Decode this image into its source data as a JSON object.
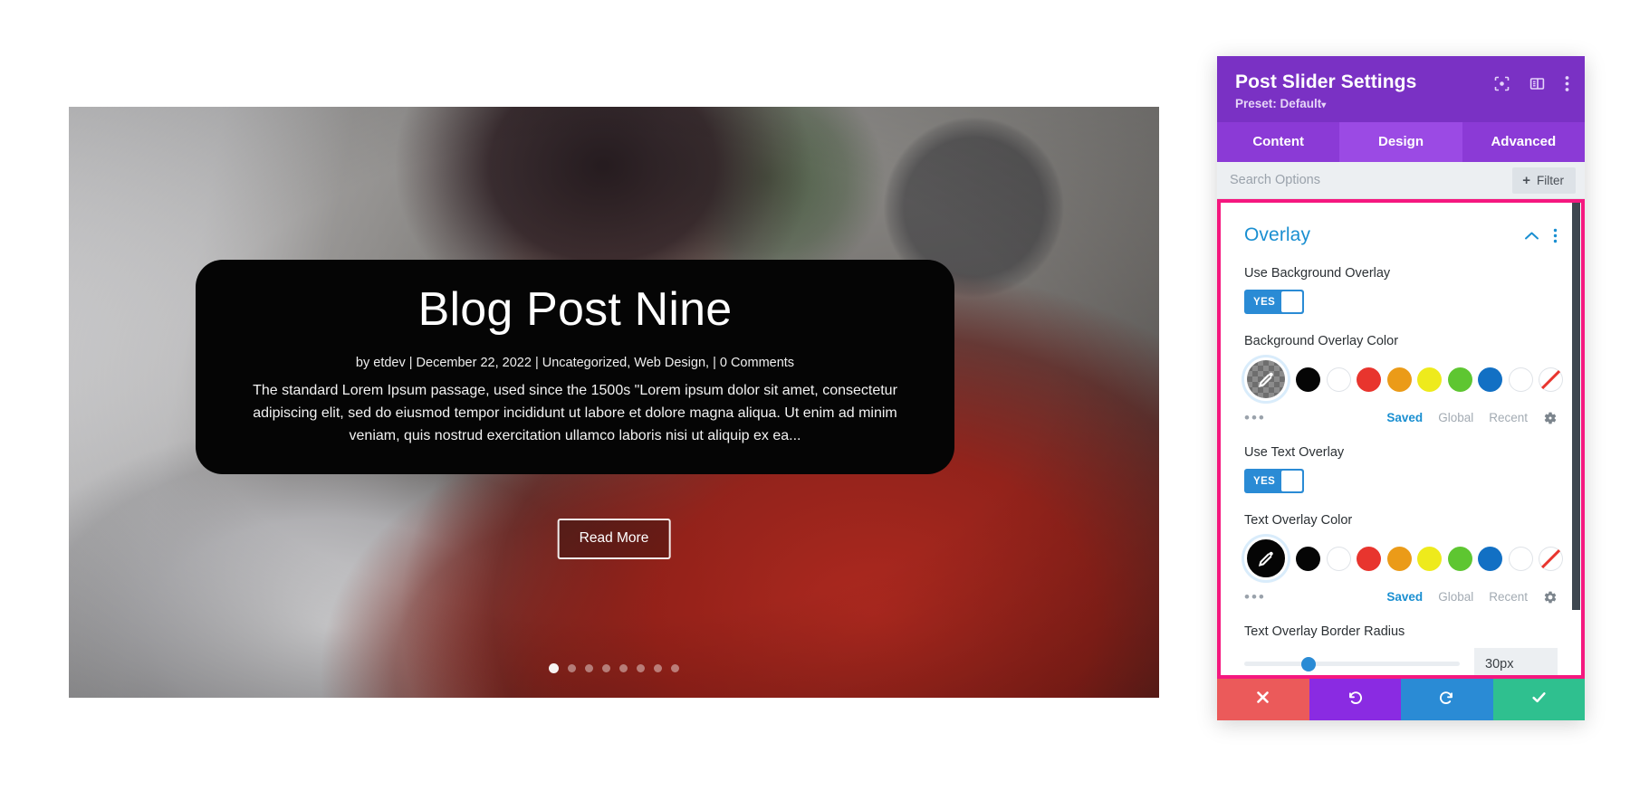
{
  "hero": {
    "post_title": "Blog Post Nine",
    "post_meta": "by etdev | December 22, 2022 | Uncategorized, Web Design, | 0 Comments",
    "post_excerpt": "The standard Lorem Ipsum passage, used since the 1500s \"Lorem ipsum dolor sit amet, consectetur adipiscing elit, sed do eiusmod tempor incididunt ut labore et dolore magna aliqua. Ut enim ad minim veniam, quis nostrud exercitation ullamco laboris nisi ut aliquip ex ea...",
    "read_more_label": "Read More",
    "slide_count": 8,
    "active_slide": 1
  },
  "modal": {
    "title": "Post Slider Settings",
    "preset": "Preset: Default",
    "preset_caret": "▾",
    "header_icons": [
      "focus-icon",
      "layout-icon",
      "overflow-menu-icon"
    ],
    "tabs": [
      {
        "label": "Content",
        "active": false
      },
      {
        "label": "Design",
        "active": true
      },
      {
        "label": "Advanced",
        "active": false
      }
    ],
    "search": {
      "value": "",
      "placeholder": "Search Options"
    },
    "filter": {
      "plus": "+",
      "label": "Filter"
    },
    "section": {
      "title": "Overlay",
      "collapse_icon": "chevron-up-icon",
      "menu_icon": "overflow-menu-icon"
    },
    "fields": {
      "use_background_overlay": {
        "label": "Use Background Overlay",
        "toggle_value": "YES"
      },
      "background_overlay_color": {
        "label": "Background Overlay Color",
        "picker_style": "checker",
        "swatches": [
          {
            "name": "black",
            "hex": "#050505",
            "ring": false,
            "none": false
          },
          {
            "name": "white",
            "hex": "#ffffff",
            "ring": true,
            "none": false
          },
          {
            "name": "red",
            "hex": "#e8352e",
            "ring": false,
            "none": false
          },
          {
            "name": "orange",
            "hex": "#eb9b18",
            "ring": false,
            "none": false
          },
          {
            "name": "yellow",
            "hex": "#eeea1c",
            "ring": false,
            "none": false
          },
          {
            "name": "green",
            "hex": "#5ec631",
            "ring": false,
            "none": false
          },
          {
            "name": "blue",
            "hex": "#1270c4",
            "ring": false,
            "none": false
          },
          {
            "name": "white-outline",
            "hex": "#ffffff",
            "ring": true,
            "none": false
          },
          {
            "name": "transparent",
            "hex": "#ffffff",
            "ring": true,
            "none": true
          }
        ],
        "more": "•••",
        "tabs": [
          {
            "label": "Saved",
            "active": true
          },
          {
            "label": "Global",
            "active": false
          },
          {
            "label": "Recent",
            "active": false
          }
        ],
        "gear": "gear-icon"
      },
      "use_text_overlay": {
        "label": "Use Text Overlay",
        "toggle_value": "YES"
      },
      "text_overlay_color": {
        "label": "Text Overlay Color",
        "picker_style": "black",
        "swatches": [
          {
            "name": "black",
            "hex": "#050505",
            "ring": false,
            "none": false
          },
          {
            "name": "white",
            "hex": "#ffffff",
            "ring": true,
            "none": false
          },
          {
            "name": "red",
            "hex": "#e8352e",
            "ring": false,
            "none": false
          },
          {
            "name": "orange",
            "hex": "#eb9b18",
            "ring": false,
            "none": false
          },
          {
            "name": "yellow",
            "hex": "#eeea1c",
            "ring": false,
            "none": false
          },
          {
            "name": "green",
            "hex": "#5ec631",
            "ring": false,
            "none": false
          },
          {
            "name": "blue",
            "hex": "#1270c4",
            "ring": false,
            "none": false
          },
          {
            "name": "white-outline",
            "hex": "#ffffff",
            "ring": true,
            "none": false
          },
          {
            "name": "transparent",
            "hex": "#ffffff",
            "ring": true,
            "none": true
          }
        ],
        "more": "•••",
        "tabs": [
          {
            "label": "Saved",
            "active": true
          },
          {
            "label": "Global",
            "active": false
          },
          {
            "label": "Recent",
            "active": false
          }
        ],
        "gear": "gear-icon"
      },
      "text_overlay_border_radius": {
        "label": "Text Overlay Border Radius",
        "value": "30px",
        "slider_percent": 30
      }
    },
    "footer_buttons": [
      {
        "name": "cancel-button",
        "icon": "close-icon",
        "color": "#eb5a5a"
      },
      {
        "name": "undo-button",
        "icon": "undo-icon",
        "color": "#8a2be2"
      },
      {
        "name": "redo-button",
        "icon": "redo-icon",
        "color": "#2a8bd5"
      },
      {
        "name": "save-button",
        "icon": "check-icon",
        "color": "#2fc08f"
      }
    ]
  },
  "colors": {
    "modal_header": "#7a31c4",
    "tab_bar": "#8b3ad6",
    "tab_active": "#9b4ae4",
    "highlight_border": "#f5187f",
    "accent_blue": "#1a8fd1",
    "toggle_blue": "#2a8bd5"
  }
}
